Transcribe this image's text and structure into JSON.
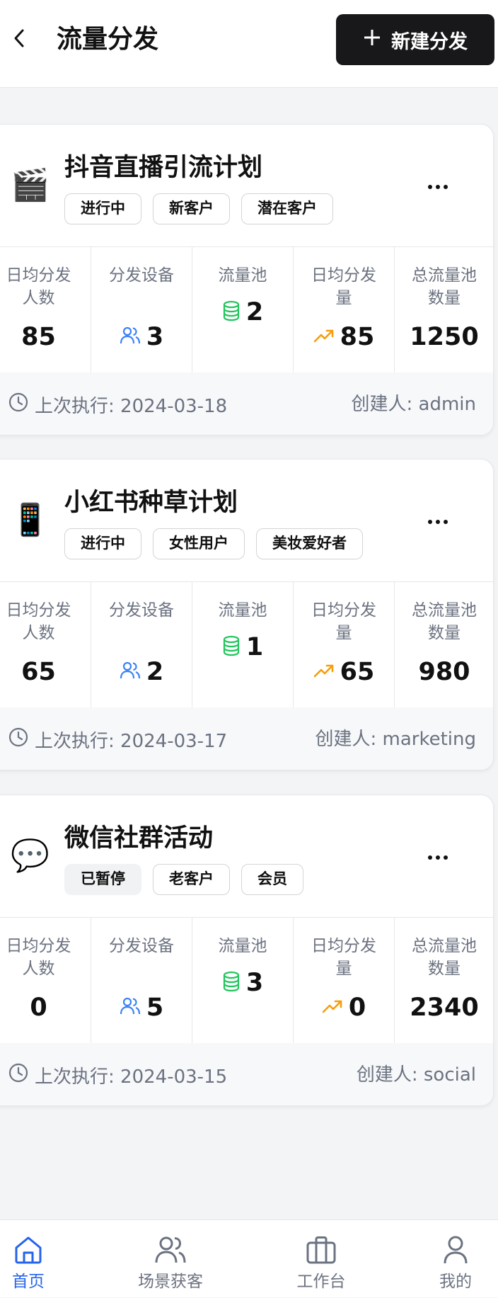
{
  "header": {
    "title": "流量分发",
    "new_button_label": "新建分发",
    "new_button_icon": "plus-icon",
    "back_icon": "chevron-left-icon"
  },
  "stat_labels": {
    "daily_people": "日均分发人数",
    "devices": "分发设备",
    "pools": "流量池",
    "daily_volume": "日均分发量",
    "total_pool": "总流量池数量"
  },
  "colors": {
    "device_icon": "#3b82f6",
    "pool_icon": "#22c55e",
    "trend_icon": "#f59e0b",
    "active_nav": "#2563eb"
  },
  "plans": [
    {
      "emoji": "🎬",
      "title": "抖音直播引流计划",
      "tags": [
        "进行中",
        "新客户",
        "潜在客户"
      ],
      "daily_people": "85",
      "devices": "3",
      "pools": "2",
      "daily_volume": "85",
      "total_pool": "1250",
      "last_run": "上次执行: 2024-03-18",
      "creator": "创建人: admin"
    },
    {
      "emoji": "📱",
      "title": "小红书种草计划",
      "tags": [
        "进行中",
        "女性用户",
        "美妆爱好者"
      ],
      "daily_people": "65",
      "devices": "2",
      "pools": "1",
      "daily_volume": "65",
      "total_pool": "980",
      "last_run": "上次执行: 2024-03-17",
      "creator": "创建人: marketing"
    },
    {
      "emoji": "💬",
      "title": "微信社群活动",
      "tags": [
        "已暂停",
        "老客户",
        "会员"
      ],
      "daily_people": "0",
      "devices": "5",
      "pools": "3",
      "daily_volume": "0",
      "total_pool": "2340",
      "last_run": "上次执行: 2024-03-15",
      "creator": "创建人: social"
    }
  ],
  "bottom_nav": [
    {
      "label": "首页",
      "icon": "home-icon"
    },
    {
      "label": "场景获客",
      "icon": "users-icon"
    },
    {
      "label": "工作台",
      "icon": "briefcase-icon"
    },
    {
      "label": "我的",
      "icon": "user-icon"
    }
  ]
}
